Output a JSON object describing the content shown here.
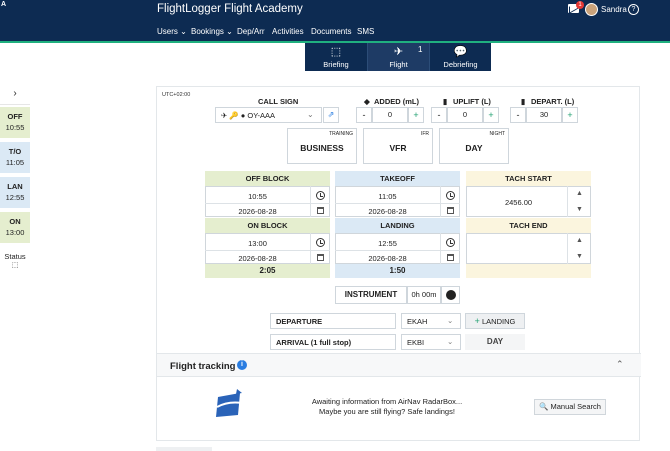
{
  "app": {
    "corner_glyph": "A",
    "brand": "FlightLogger Flight Academy",
    "notification_count": "1",
    "user_name": "Sandra",
    "help_symbol": "?",
    "icons": [
      "mail-icon",
      "avatar",
      "help-icon"
    ]
  },
  "nav": {
    "items": [
      "Users ⌄",
      "Bookings ⌄",
      "Dep/Arr",
      "Activities",
      "Documents",
      "SMS"
    ]
  },
  "tabs": {
    "items": [
      {
        "label": "Briefing",
        "icon": "whiteboard-icon",
        "glyph": "⬚"
      },
      {
        "label": "Flight",
        "icon": "airplane-icon",
        "glyph": "✈"
      },
      {
        "label": "Debriefing",
        "icon": "chat-icon",
        "glyph": "💬"
      }
    ],
    "flight_count": "1"
  },
  "sidebar": {
    "arrow": "›",
    "items": [
      {
        "title": "OFF",
        "value": "10:55"
      },
      {
        "title": "T/O",
        "value": "11:05"
      },
      {
        "title": "LAN",
        "value": "12:55"
      },
      {
        "title": "ON",
        "value": "13:00"
      }
    ],
    "status_label": "Status",
    "status_icon": "⬚"
  },
  "form": {
    "timezone": "UTC+02:00",
    "callsign": {
      "label": "CALL SIGN",
      "value": "✈ 🔑 ● OY-AAA",
      "icons": [
        "airplane-icon",
        "key-icon",
        "dot-icon"
      ]
    },
    "added": {
      "label": "ADDED (mL)",
      "value": "0",
      "icon": "oil-icon",
      "icon_glyph": "◆"
    },
    "uplift": {
      "label": "UPLIFT (L)",
      "value": "0",
      "icon": "fuel-icon",
      "icon_glyph": "▮"
    },
    "depart": {
      "label": "DEPART. (L)",
      "value": "30",
      "icon": "fuel-icon",
      "icon_glyph": "▮"
    },
    "minus": "-",
    "plus": "+",
    "flight_types": [
      {
        "small": "TRAINING",
        "main": "BUSINESS"
      },
      {
        "small": "IFR",
        "main": "VFR"
      },
      {
        "small": "NIGHT",
        "main": "DAY"
      }
    ],
    "times": {
      "off_block": {
        "label": "OFF BLOCK",
        "time": "10:55",
        "date": "2026-08-28"
      },
      "takeoff": {
        "label": "TAKEOFF",
        "time": "11:05",
        "date": "2026-08-28"
      },
      "on_block": {
        "label": "ON BLOCK",
        "time": "13:00",
        "date": "2026-08-28"
      },
      "landing": {
        "label": "LANDING",
        "time": "12:55",
        "date": "2026-08-28"
      },
      "block_total": "2:05",
      "air_total": "1:50"
    },
    "tach": {
      "start_label": "TACH START",
      "start_value": "2456.00",
      "end_label": "TACH END",
      "end_value": ""
    },
    "instrument": {
      "label": "INSTRUMENT",
      "value": "0h 00m"
    },
    "departure": {
      "label": "DEPARTURE",
      "airport": "EKAH"
    },
    "arrival": {
      "label": "ARRIVAL (1 full stop)",
      "airport": "EKBI",
      "period": "DAY"
    },
    "landing_button": "LANDING"
  },
  "tracking": {
    "title": "Flight tracking",
    "info_symbol": "i",
    "chevron": "⌃",
    "message_line1": "Awaiting information from AirNav RadarBox...",
    "message_line2": "Maybe you are still flying? Safe landings!",
    "manual_search": "Manual Search",
    "colors": {
      "accent": "#20b07f",
      "navy": "#0d2b52",
      "green_cell": "#e5eecf",
      "blue_cell": "#dbe9f5",
      "cream_cell": "#fbf5de"
    }
  }
}
